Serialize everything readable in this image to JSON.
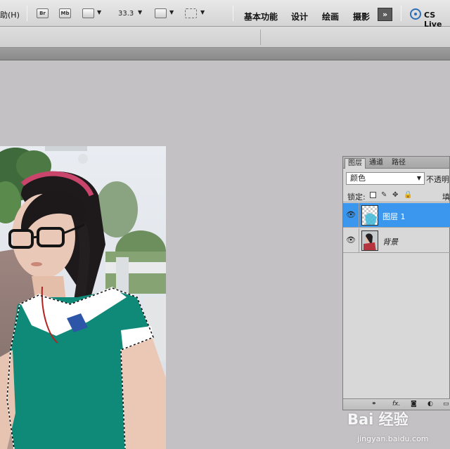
{
  "app": {
    "menu_help": "助(H)",
    "toolbar": {
      "bridge_icon": "Br",
      "minibridge_icon": "Mb",
      "zoom": "33.3",
      "dropdown_glyph": "▼"
    },
    "workspaces": [
      "基本功能",
      "设计",
      "绘画",
      "摄影"
    ],
    "more_glyph": "»",
    "cslive": "CS Live"
  },
  "layers_panel": {
    "tabs": [
      "图层",
      "通道",
      "路径"
    ],
    "blend_mode": "颜色",
    "opacity_label": "不透明",
    "lock_label": "锁定:",
    "fill_label": "填",
    "layers": [
      {
        "name": "图层 1",
        "selected": true,
        "visible": true
      },
      {
        "name": "背景",
        "selected": false,
        "visible": true
      }
    ],
    "footer_icons": [
      "link-icon",
      "fx-icon",
      "mask-icon",
      "adjustment-icon",
      "folder-icon"
    ],
    "footer_fx": "fx."
  },
  "watermark": {
    "logo": "Bai 经验",
    "url": "jingyan.baidu.com"
  },
  "colors": {
    "selection_blue": "#3b97ee",
    "workspace_gray": "#c3c1c4",
    "shirt_teal": "#0f8a78"
  }
}
